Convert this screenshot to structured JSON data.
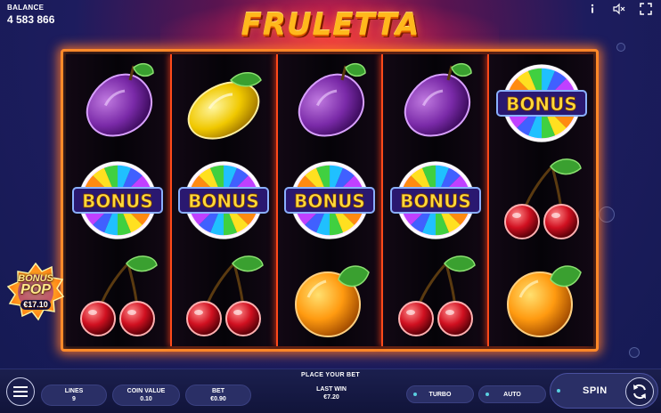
{
  "header": {
    "balance_label": "BALANCE",
    "balance_value": "4 583 866",
    "logo_text": "FRULETTA",
    "icons": [
      "info-icon",
      "sound-muted-icon",
      "fullscreen-icon"
    ]
  },
  "reels": [
    [
      "plum",
      "bonus",
      "cherries"
    ],
    [
      "lemon",
      "bonus",
      "cherries"
    ],
    [
      "plum",
      "bonus",
      "orange"
    ],
    [
      "plum",
      "bonus",
      "cherries"
    ],
    [
      "bonus",
      "cherries",
      "orange"
    ]
  ],
  "symbols": {
    "bonus_label": "BONUS"
  },
  "bonus_pop": {
    "line1": "BONUS",
    "line2": "POP",
    "amount": "€17.10"
  },
  "controls": {
    "prompt": "PLACE YOUR BET",
    "lines_label": "LINES",
    "lines_value": "9",
    "coin_value_label": "COIN VALUE",
    "coin_value_value": "0.10",
    "bet_label": "BET",
    "bet_value": "€0.90",
    "last_win_label": "LAST WIN",
    "last_win_value": "€7.20",
    "turbo_label": "TURBO",
    "auto_label": "AUTO",
    "spin_label": "SPIN"
  },
  "colors": {
    "frame": "#ff8a2a",
    "accent": "#5ad0e0",
    "logo": "#ffb81c"
  }
}
